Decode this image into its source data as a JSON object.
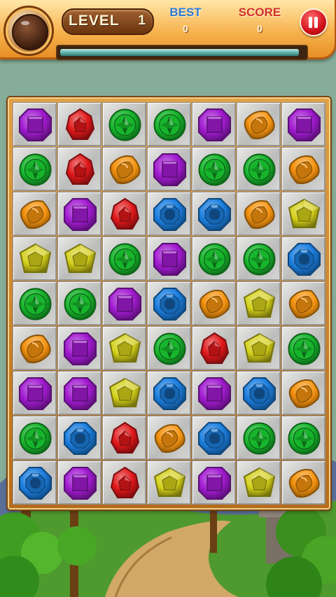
{
  "hud": {
    "level_label": "LEVEL",
    "level_value": "1",
    "best_label": "BEST",
    "best_value": "0",
    "score_label": "SCORE",
    "score_value": "0",
    "progress": 0.98
  },
  "colors": {
    "purple": "#a21bd1",
    "red": "#e0181a",
    "green": "#17b52c",
    "orange": "#f5930f",
    "blue": "#1c7fe0",
    "yellow": "#d4d019"
  },
  "board": {
    "rows": 9,
    "cols": 7,
    "cells": [
      [
        "purple",
        "red",
        "green",
        "green",
        "purple",
        "orange",
        "purple"
      ],
      [
        "green",
        "red",
        "orange",
        "purple",
        "green",
        "green",
        "orange"
      ],
      [
        "orange",
        "purple",
        "red",
        "blue",
        "blue",
        "orange",
        "yellow"
      ],
      [
        "yellow",
        "yellow",
        "green",
        "purple",
        "green",
        "green",
        "blue"
      ],
      [
        "green",
        "green",
        "purple",
        "blue",
        "orange",
        "yellow",
        "orange"
      ],
      [
        "orange",
        "purple",
        "yellow",
        "green",
        "red",
        "yellow",
        "green"
      ],
      [
        "purple",
        "purple",
        "yellow",
        "blue",
        "purple",
        "blue",
        "orange"
      ],
      [
        "green",
        "blue",
        "red",
        "orange",
        "blue",
        "green",
        "green"
      ],
      [
        "blue",
        "purple",
        "red",
        "yellow",
        "purple",
        "yellow",
        "orange"
      ]
    ]
  }
}
